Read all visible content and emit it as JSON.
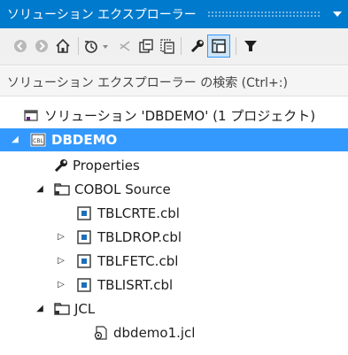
{
  "title_bar": {
    "title": "ソリューション エクスプローラー",
    "menu_icon": "dropdown-arrow-icon"
  },
  "toolbar": {
    "buttons": [
      "back-icon",
      "forward-icon",
      "home-icon",
      "history-icon",
      "sync-icon",
      "collapse-all-icon",
      "show-all-files-icon",
      "properties-icon",
      "preview-icon",
      "filter-icon"
    ],
    "active_button": "preview-icon"
  },
  "search": {
    "placeholder": "ソリューション エクスプローラー の検索 (Ctrl+:)"
  },
  "tree": {
    "solution": {
      "label": "ソリューション 'DBDEMO' (1 プロジェクト)"
    },
    "project": {
      "label": "DBDEMO",
      "selected": true
    },
    "properties": {
      "label": "Properties"
    },
    "cobol_folder": {
      "label": "COBOL Source"
    },
    "file_tblcrte": {
      "label": "TBLCRTE.cbl"
    },
    "file_tbldrop": {
      "label": "TBLDROP.cbl"
    },
    "file_tblfetc": {
      "label": "TBLFETC.cbl"
    },
    "file_tblisrt": {
      "label": "TBLISRT.cbl"
    },
    "jcl_folder": {
      "label": "JCL"
    },
    "file_dbdemo1": {
      "label": "dbdemo1.jcl"
    }
  },
  "colors": {
    "accent": "#007acc",
    "selection": "#3399ff",
    "toolbar_bg": "#f0f0f0"
  }
}
